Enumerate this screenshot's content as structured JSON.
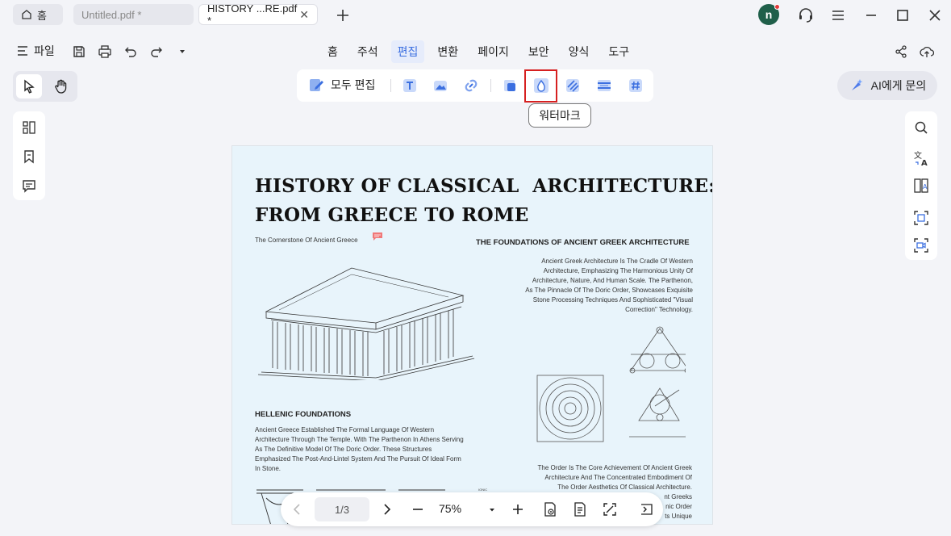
{
  "tabs": {
    "home_label": "홈",
    "untitled_label": "Untitled.pdf *",
    "history_label": "HISTORY ...RE.pdf *",
    "close_glyph": "✕"
  },
  "user": {
    "avatar_letter": "n"
  },
  "menu": {
    "file_label": "파일",
    "tabs": [
      "홈",
      "주석",
      "편집",
      "변환",
      "페이지",
      "보안",
      "양식",
      "도구"
    ],
    "active_tab": "편집"
  },
  "ribbon": {
    "edit_all_label": "모두 편집",
    "tooltip": "워터마크"
  },
  "ai": {
    "label": "AI에게 문의"
  },
  "document": {
    "title_line1": "HISTORY OF CLASSICAL  ARCHITECTURE:",
    "title_line2": "FROM GREECE TO ROME",
    "subtitle": "The Cornerstone Of Ancient Greece",
    "section1_heading": "THE FOUNDATIONS OF ANCIENT GREEK ARCHITECTURE",
    "section1_lines": [
      "Ancient Greek Architecture Is The Cradle Of Western",
      "Architecture, Emphasizing The Harmonious Unity Of",
      "Architecture, Nature, And Human Scale. The Parthenon,",
      "As The Pinnacle Of The Doric Order, Showcases Exquisite",
      "Stone Processing Techniques And Sophisticated \"Visual",
      "Correction\" Technology."
    ],
    "section2_heading": "HELLENIC FOUNDATIONS",
    "section2_lines": [
      "Ancient Greece Established The Formal Language Of Western",
      "Architecture Through The Temple. With The Parthenon In Athens Serving",
      "As The Definitive Model Of The Doric Order. These Structures",
      "Emphasized The Post-And-Lintel System And The Pursuit Of Ideal Form",
      "In Stone."
    ],
    "section3_lines": [
      "The Order Is The Core Achievement Of Ancient Greek",
      "Architecture And The Concentrated Embodiment Of",
      "The Order Aesthetics Of Classical Architecture.",
      "nt Greeks",
      "nic Order",
      "ts Unique"
    ],
    "ionic_label": "IONIC"
  },
  "bottom": {
    "page_indicator": "1/3",
    "zoom": "75%"
  },
  "colors": {
    "accent": "#3b6fe0",
    "highlight": "#d62020",
    "page_bg": "#e8f4fb",
    "avatar": "#1f5f4a"
  }
}
